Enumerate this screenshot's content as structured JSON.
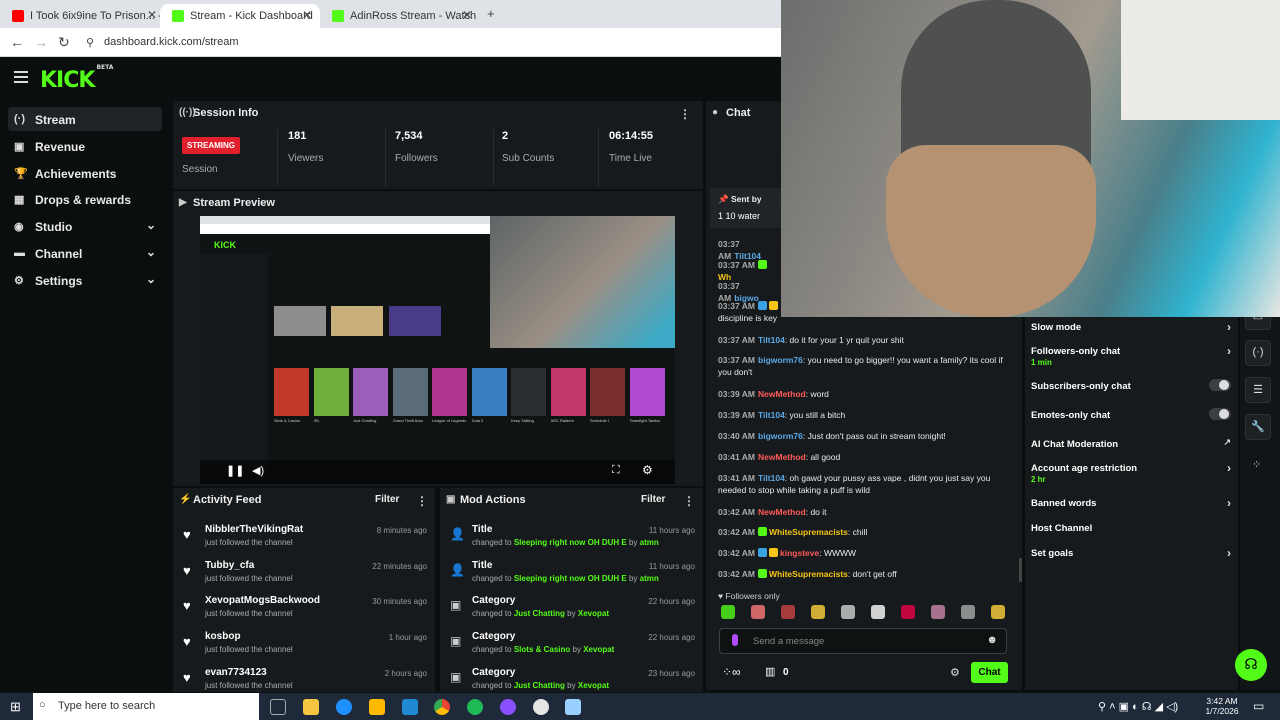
{
  "browser": {
    "tabs": [
      {
        "label": "I Took 6ix9ine To Prison... - YouTube",
        "icon": "youtube-icon",
        "color": "#ff0000"
      },
      {
        "label": "Stream - Kick Dashboard",
        "icon": "kick-icon",
        "color": "#53fc18"
      },
      {
        "label": "AdinRoss Stream - Watch Live",
        "icon": "kick-icon",
        "color": "#53fc18"
      }
    ],
    "new_tab": "+",
    "url": "dashboard.kick.com/stream"
  },
  "header": {
    "logo": "KICK",
    "logo_tag": "BETA"
  },
  "sidebar": {
    "items": [
      {
        "label": "Stream",
        "icon": "stream-icon",
        "glyph": "(·)",
        "active": true,
        "chevron": false
      },
      {
        "label": "Revenue",
        "icon": "revenue-icon",
        "glyph": "▣",
        "active": false,
        "chevron": false
      },
      {
        "label": "Achievements",
        "icon": "trophy-icon",
        "glyph": "🏆",
        "active": false,
        "chevron": false
      },
      {
        "label": "Drops & rewards",
        "icon": "drops-icon",
        "glyph": "▦",
        "active": false,
        "chevron": false
      },
      {
        "label": "Studio",
        "icon": "studio-icon",
        "glyph": "◉",
        "active": false,
        "chevron": true
      },
      {
        "label": "Channel",
        "icon": "channel-icon",
        "glyph": "▬",
        "active": false,
        "chevron": true
      },
      {
        "label": "Settings",
        "icon": "gear-icon",
        "glyph": "⚙",
        "active": false,
        "chevron": true
      }
    ]
  },
  "session": {
    "title": "Session Info",
    "status_badge": "STREAMING",
    "status_label": "Session",
    "stats": [
      {
        "value": "181",
        "label": "Viewers"
      },
      {
        "value": "7,534",
        "label": "Followers"
      },
      {
        "value": "2",
        "label": "Sub Counts"
      },
      {
        "value": "06:14:55",
        "label": "Time Live"
      }
    ]
  },
  "preview": {
    "title": "Stream Preview",
    "categories": [
      "Slots & Casino",
      "IRL",
      "Just Chatting",
      "Grand Theft Auto",
      "League of Legends",
      "Dota 2",
      "Keep Talking",
      "ARC Raiders",
      "Schedule I",
      "Teamfight Tactics"
    ]
  },
  "activity": {
    "title": "Activity Feed",
    "filter": "Filter",
    "items": [
      {
        "name": "NibblerTheVikingRat",
        "sub": "just followed the channel",
        "time": "8 minutes ago"
      },
      {
        "name": "Tubby_cfa",
        "sub": "just followed the channel",
        "time": "22 minutes ago"
      },
      {
        "name": "XevopatMogsBackwood",
        "sub": "just followed the channel",
        "time": "30 minutes ago"
      },
      {
        "name": "kosbop",
        "sub": "just followed the channel",
        "time": "1 hour ago"
      },
      {
        "name": "evan7734123",
        "sub": "just followed the channel",
        "time": "2 hours ago"
      }
    ]
  },
  "mod": {
    "title": "Mod Actions",
    "filter": "Filter",
    "items": [
      {
        "type": "Title",
        "prefix": "changed to",
        "value": "Sleeping right now OH DUH E",
        "by": "by",
        "user": "atmn",
        "time": "11 hours ago"
      },
      {
        "type": "Title",
        "prefix": "changed to",
        "value": "Sleeping right now OH DUH E",
        "by": "by",
        "user": "atmn",
        "time": "11 hours ago"
      },
      {
        "type": "Category",
        "prefix": "changed to",
        "value": "Just Chatting",
        "by": "by",
        "user": "Xevopat",
        "time": "22 hours ago"
      },
      {
        "type": "Category",
        "prefix": "changed to",
        "value": "Slots & Casino",
        "by": "by",
        "user": "Xevopat",
        "time": "22 hours ago"
      },
      {
        "type": "Category",
        "prefix": "changed to",
        "value": "Just Chatting",
        "by": "by",
        "user": "Xevopat",
        "time": "23 hours ago"
      }
    ]
  },
  "chat": {
    "title": "Chat",
    "pinned": {
      "label": "Sent by",
      "text": "1 10 water"
    },
    "messages": [
      {
        "time": "03:37 AM",
        "user": "Tilt104",
        "color": "#5aa9e6",
        "badges": [],
        "text": ""
      },
      {
        "time": "03:37 AM",
        "user": "Wh",
        "color": "#f5c518",
        "badges": [
          "g"
        ],
        "text": ""
      },
      {
        "time": "03:37 AM",
        "user": "bigwo",
        "color": "#5aa9e6",
        "badges": [],
        "text": ""
      },
      {
        "time": "03:37 AM",
        "user": "",
        "color": "#5aa9e6",
        "badges": [
          "b",
          "y"
        ],
        "text": "discipline is key"
      },
      {
        "time": "03:37 AM",
        "user": "Tilt104",
        "color": "#5aa9e6",
        "badges": [],
        "text": "do it for your 1 yr quit your shit"
      },
      {
        "time": "03:37 AM",
        "user": "bigworm76",
        "color": "#5aa9e6",
        "badges": [],
        "text": "you need to go bigger!! you want a family? its cool if you don't"
      },
      {
        "time": "03:39 AM",
        "user": "NewMethod",
        "color": "#ff5a5a",
        "badges": [],
        "text": "word"
      },
      {
        "time": "03:39 AM",
        "user": "Tilt104",
        "color": "#5aa9e6",
        "badges": [],
        "text": "you still a bitch"
      },
      {
        "time": "03:40 AM",
        "user": "bigworm76",
        "color": "#5aa9e6",
        "badges": [],
        "text": "Just don't pass out in stream tonight!"
      },
      {
        "time": "03:41 AM",
        "user": "NewMethod",
        "color": "#ff5a5a",
        "badges": [],
        "text": "all good"
      },
      {
        "time": "03:41 AM",
        "user": "Tilt104",
        "color": "#5aa9e6",
        "badges": [],
        "text": "oh gawd your pussy ass vape , didnt you just say you needed to stop while taking a puff is wild"
      },
      {
        "time": "03:42 AM",
        "user": "NewMethod",
        "color": "#ff5a5a",
        "badges": [],
        "text": "do it"
      },
      {
        "time": "03:42 AM",
        "user": "WhiteSupremacists",
        "color": "#f5c518",
        "badges": [
          "g"
        ],
        "text": "chill"
      },
      {
        "time": "03:42 AM",
        "user": "kingsteve",
        "color": "#ff5a5a",
        "badges": [
          "b",
          "y"
        ],
        "text": "WWWW"
      },
      {
        "time": "03:42 AM",
        "user": "WhiteSupremacists",
        "color": "#f5c518",
        "badges": [
          "g"
        ],
        "text": "don't get off"
      }
    ],
    "followers_only": "Followers only",
    "input_placeholder": "Send a message",
    "count": "0",
    "send": "Chat"
  },
  "chat_settings": {
    "items": [
      {
        "label": "Slow mode",
        "sub": "",
        "control": "chevron"
      },
      {
        "label": "Followers-only chat",
        "sub": "1 min",
        "control": "chevron"
      },
      {
        "label": "Subscribers-only chat",
        "sub": "",
        "control": "toggle"
      },
      {
        "label": "Emotes-only chat",
        "sub": "",
        "control": "toggle"
      },
      {
        "label": "AI Chat Moderation",
        "sub": "",
        "control": "external"
      },
      {
        "label": "Account age restriction",
        "sub": "2 hr",
        "control": "chevron"
      },
      {
        "label": "Banned words",
        "sub": "",
        "control": "chevron"
      },
      {
        "label": "Host Channel",
        "sub": "",
        "control": "none"
      },
      {
        "label": "Set goals",
        "sub": "",
        "control": "chevron"
      }
    ]
  },
  "taskbar": {
    "search_placeholder": "Type here to search",
    "time": "3:42 AM",
    "date": "1/7/2026"
  }
}
